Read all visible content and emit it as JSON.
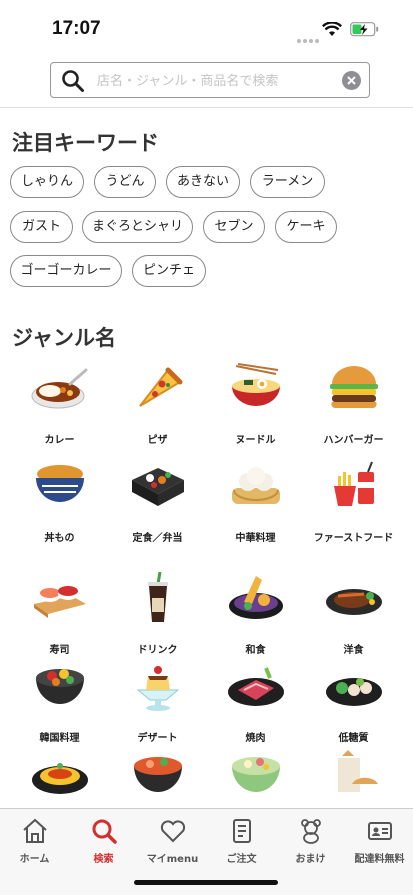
{
  "status": {
    "time": "17:07"
  },
  "search": {
    "placeholder": "店名・ジャンル・商品名で検索"
  },
  "keywords": {
    "title": "注目キーワード",
    "chips": [
      "しゃりん",
      "うどん",
      "あきない",
      "ラーメン",
      "ガスト",
      "まぐろとシャリ",
      "セブン",
      "ケーキ",
      "ゴーゴーカレー",
      "ピンチェ"
    ]
  },
  "genres": {
    "title": "ジャンル名",
    "items": [
      {
        "label": "カレー",
        "icon": "curry-icon"
      },
      {
        "label": "ピザ",
        "icon": "pizza-icon"
      },
      {
        "label": "ヌードル",
        "icon": "noodle-icon"
      },
      {
        "label": "ハンバーガー",
        "icon": "hamburger-icon"
      },
      {
        "label": "丼もの",
        "icon": "donburi-icon"
      },
      {
        "label": "定食／弁当",
        "icon": "bento-icon"
      },
      {
        "label": "中華料理",
        "icon": "dimsum-icon"
      },
      {
        "label": "ファーストフード",
        "icon": "fastfood-icon"
      },
      {
        "label": "寿司",
        "icon": "sushi-icon"
      },
      {
        "label": "ドリンク",
        "icon": "drink-icon"
      },
      {
        "label": "和食",
        "icon": "tempura-icon"
      },
      {
        "label": "洋食",
        "icon": "steak-icon"
      },
      {
        "label": "韓国料理",
        "icon": "bibimbap-icon"
      },
      {
        "label": "デザート",
        "icon": "pudding-icon"
      },
      {
        "label": "焼肉",
        "icon": "yakiniku-icon"
      },
      {
        "label": "低糖質",
        "icon": "lowcarb-icon"
      },
      {
        "label": "",
        "icon": "pasta-icon"
      },
      {
        "label": "",
        "icon": "soup-icon"
      },
      {
        "label": "",
        "icon": "salad-icon"
      },
      {
        "label": "",
        "icon": "bread-icon"
      }
    ]
  },
  "tabs": [
    {
      "label": "ホーム",
      "icon": "home-icon",
      "active": false
    },
    {
      "label": "検索",
      "icon": "search-icon",
      "active": true
    },
    {
      "label": "マイmenu",
      "icon": "heart-icon",
      "active": false
    },
    {
      "label": "ご注文",
      "icon": "receipt-icon",
      "active": false
    },
    {
      "label": "おまけ",
      "icon": "bear-icon",
      "active": false
    },
    {
      "label": "配達料無料",
      "icon": "id-card-icon",
      "active": false
    }
  ],
  "colors": {
    "accent": "#d32f2f"
  }
}
